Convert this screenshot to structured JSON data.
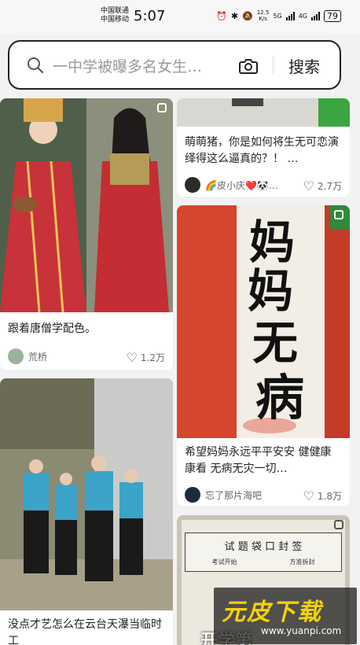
{
  "status_bar": {
    "carrier_1": "中国联通",
    "carrier_2": "中国移动",
    "time": "5:07",
    "net_speed_value": "12.5",
    "net_speed_unit": "K/s",
    "net_type_1": "5G",
    "net_type_2": "4G",
    "battery": "79"
  },
  "search": {
    "query": "一中学被曝多名女生…",
    "button_label": "搜索"
  },
  "feed": {
    "left": [
      {
        "title": "跟着唐僧学配色。",
        "author": "荒桥",
        "likes": "1.2万"
      },
      {
        "title": "没点才艺怎么在云台天瀑当临时工",
        "author": "",
        "likes": ""
      }
    ],
    "right": [
      {
        "title": "萌萌猪，你是如何将生无可恋演绎得这么逼真的？！ …",
        "author": "🌈皮小庆❤️🐼…",
        "likes": "2.7万"
      },
      {
        "title": "希望妈妈永远平平安安 健健康康看 无病无灾一切…",
        "author": "忘了那片海吧",
        "likes": "1.8万",
        "calligraphy": [
          "妈",
          "妈",
          "无",
          "病"
        ]
      },
      {
        "title": "",
        "author": "",
        "likes": "",
        "paper_title": "试 题 袋 口 封 签",
        "paper_sub_1": "考试开始",
        "paper_sub_2": "方准拆封",
        "overlay_text": "开学第"
      }
    ]
  },
  "watermark": {
    "logo": "元皮下载",
    "url": "www.yuanpi.com"
  },
  "colors": {
    "accent": "#222222",
    "robe_red": "#c8323a",
    "card_bg": "#ffffff",
    "page_bg": "#f2f2f2",
    "watermark_yellow": "#f5d300"
  }
}
